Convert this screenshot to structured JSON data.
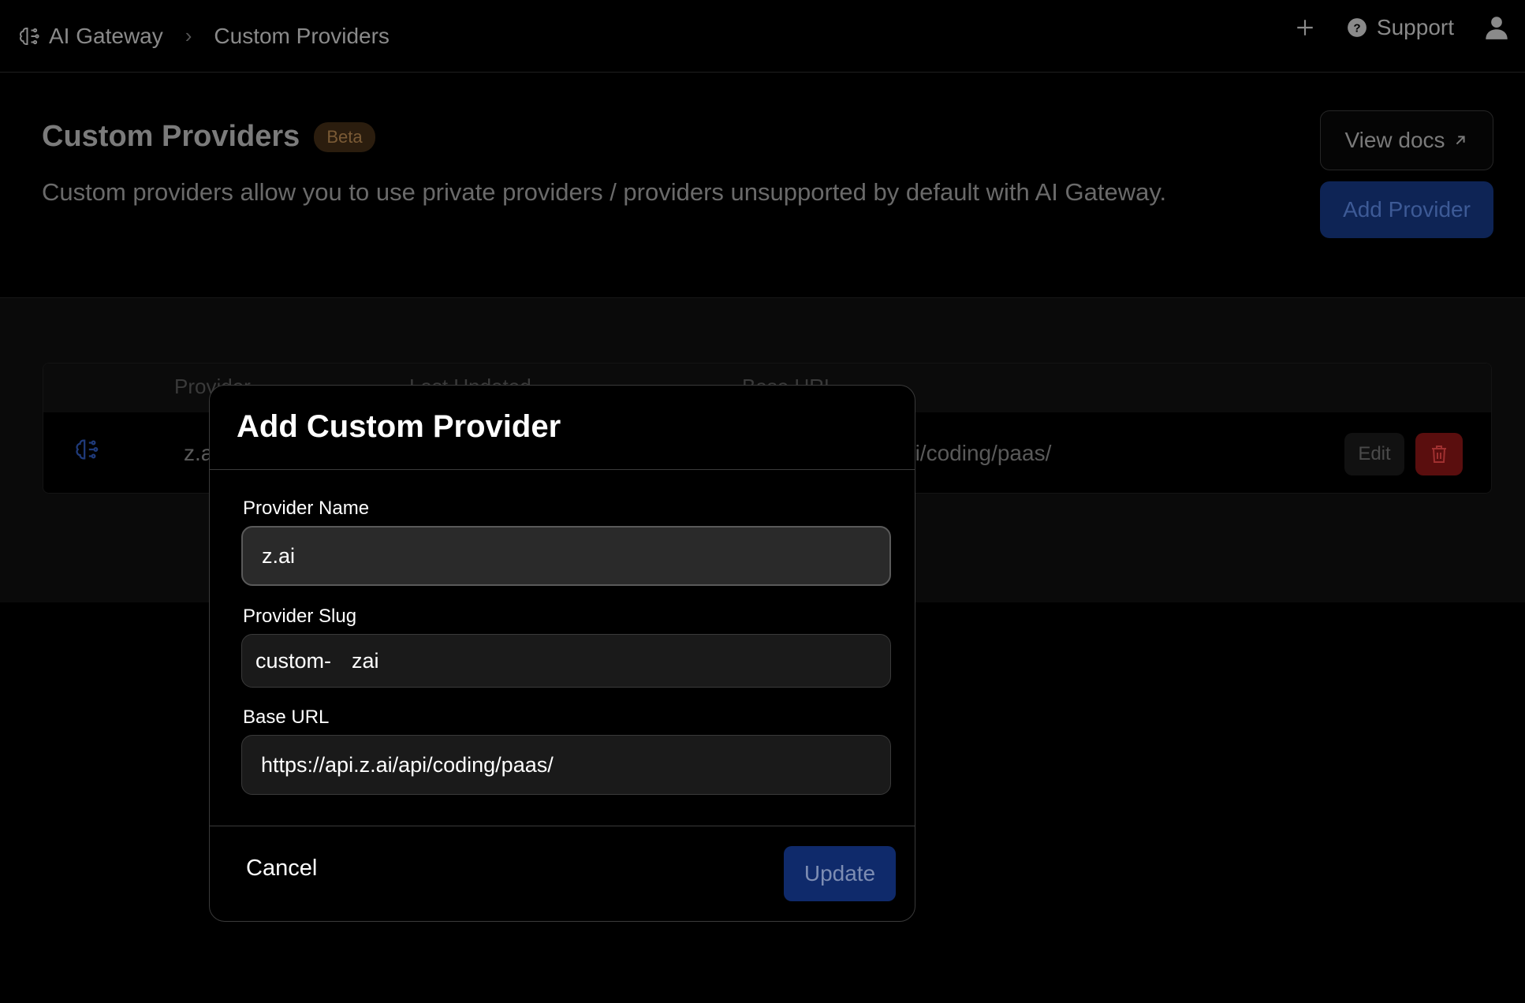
{
  "breadcrumb": {
    "app": "AI Gateway",
    "separator": "›",
    "page": "Custom Providers"
  },
  "topbar": {
    "support_label": "Support"
  },
  "header": {
    "title": "Custom Providers",
    "badge": "Beta",
    "description": "Custom providers allow you to use private providers / providers unsupported by default with AI Gateway.",
    "view_docs_label": "View docs",
    "add_provider_label": "Add Provider"
  },
  "table": {
    "columns": [
      "Provider",
      "Last Updated",
      "Base URL"
    ],
    "rows": [
      {
        "name": "z.a",
        "base_url": "pi/coding/paas/",
        "edit_label": "Edit"
      }
    ]
  },
  "modal": {
    "title": "Add Custom Provider",
    "name_label": "Provider Name",
    "name_value": "z.ai",
    "slug_label": "Provider Slug",
    "slug_prefix": "custom-",
    "slug_value": "zai",
    "url_label": "Base URL",
    "url_value": "https://api.z.ai/api/coding/paas/",
    "cancel_label": "Cancel",
    "update_label": "Update"
  },
  "colors": {
    "accent": "#0f2a6b",
    "danger": "#5a0e0e",
    "badge_bg": "#2b1d0e"
  }
}
